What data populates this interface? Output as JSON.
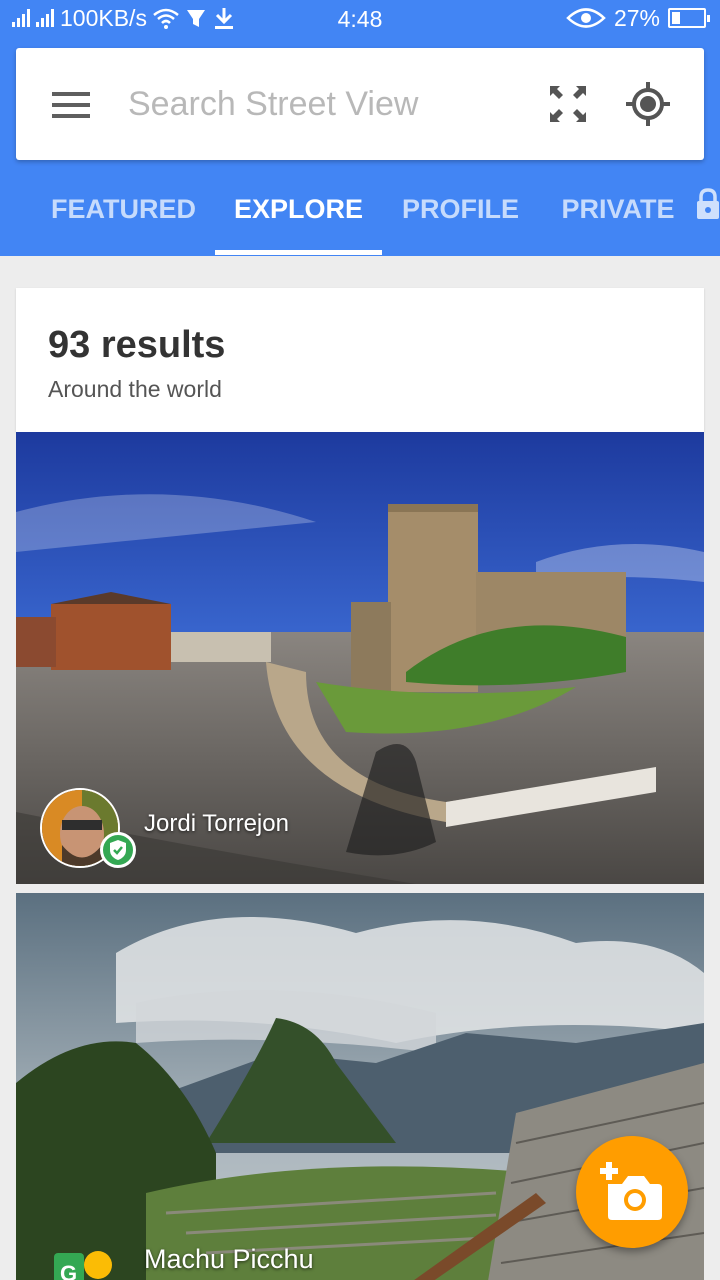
{
  "status_bar": {
    "network_speed": "100KB/s",
    "time": "4:48",
    "battery_percent": "27%",
    "battery_level": 0.27
  },
  "search": {
    "placeholder": "Search Street View"
  },
  "tabs": [
    {
      "label": "FEATURED",
      "active": false
    },
    {
      "label": "EXPLORE",
      "active": true
    },
    {
      "label": "PROFILE",
      "active": false
    },
    {
      "label": "PRIVATE",
      "active": false
    }
  ],
  "results": {
    "count_label": "93 results",
    "subtitle": "Around the world"
  },
  "photos": [
    {
      "author": "Jordi Torrejon",
      "verified": true
    },
    {
      "author": "Machu Picchu"
    }
  ],
  "icons": {
    "menu": "hamburger-menu-icon",
    "expand": "fullscreen-icon",
    "locate": "my-location-icon",
    "lock": "lock-icon",
    "fab": "add-photo-icon"
  },
  "colors": {
    "primary": "#4285f4",
    "fab": "#ff9d00",
    "verified": "#34a853"
  }
}
